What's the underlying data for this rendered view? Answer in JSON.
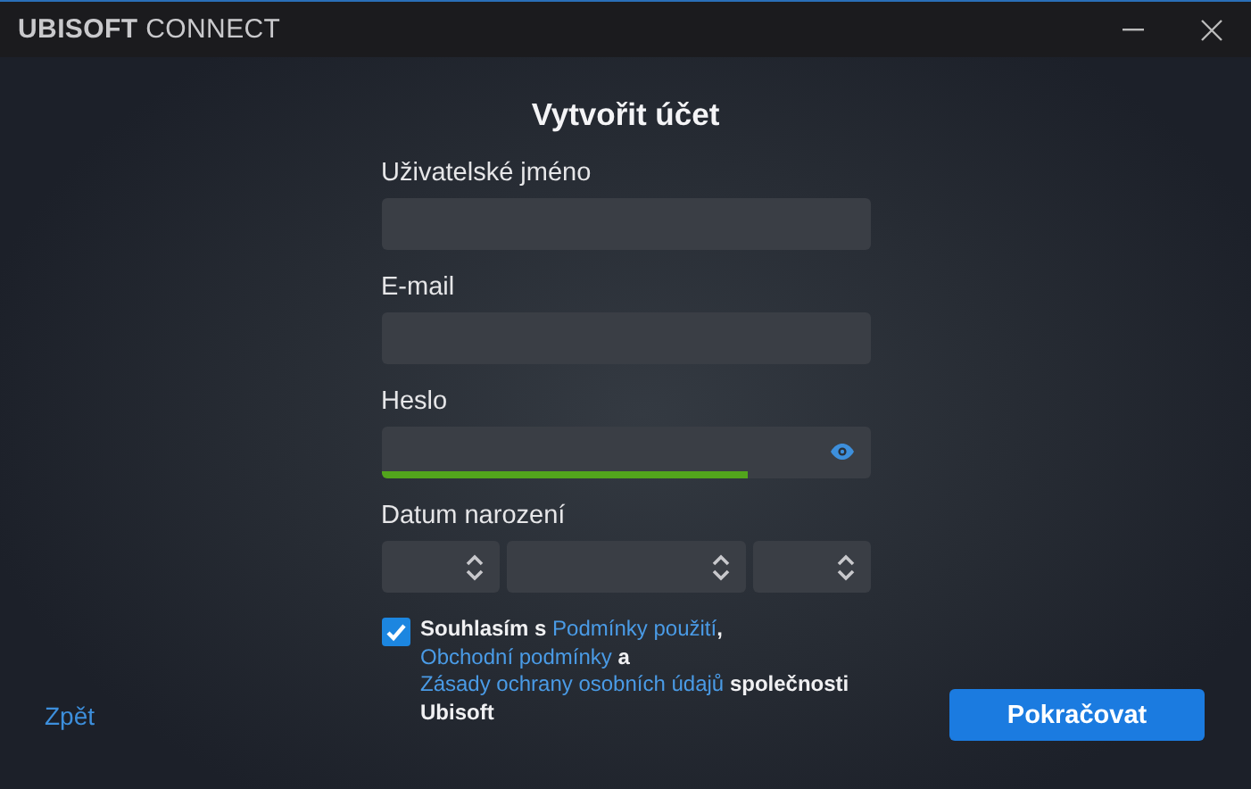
{
  "window": {
    "brand": "UBISOFT",
    "product": "CONNECT",
    "controls": [
      {
        "kind": "minimize"
      },
      {
        "kind": "close"
      }
    ]
  },
  "heading": "Vytvořit účet",
  "fields": [
    {
      "kind": "text",
      "label": "Uživatelské jméno"
    },
    {
      "kind": "text",
      "label": "E-mail"
    },
    {
      "kind": "password",
      "label": "Heslo",
      "level": 0.75
    },
    {
      "kind": "date",
      "label": "Datum narození"
    }
  ],
  "consent": {
    "checked": true,
    "lines": [
      [
        {
          "kind": "text",
          "text": "Souhlasím s "
        },
        {
          "kind": "link",
          "text": "Podmínky použití"
        },
        {
          "kind": "text",
          "text": ","
        }
      ],
      [
        {
          "kind": "link",
          "text": "Obchodní podmínky"
        },
        {
          "kind": "text",
          "text": " a"
        }
      ],
      [
        {
          "kind": "link",
          "text": "Zásady ochrany osobních údajů"
        },
        {
          "kind": "text",
          "text": " společnosti"
        }
      ],
      [
        {
          "kind": "text",
          "text": "Ubisoft"
        }
      ]
    ]
  },
  "back": "Zpět",
  "submit": "Pokračovat"
}
